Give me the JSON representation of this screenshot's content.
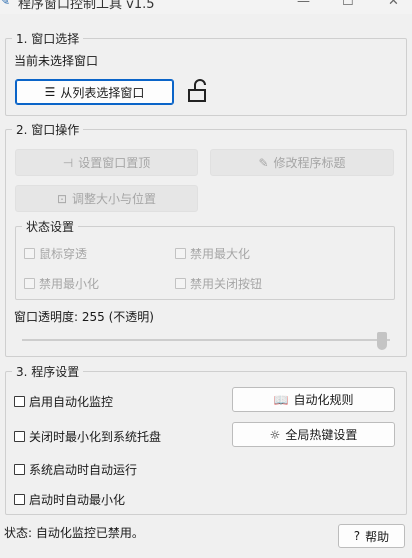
{
  "window": {
    "title": "程序窗口控制工具 v1.5"
  },
  "section_select": {
    "legend": "1. 窗口选择",
    "current_window_text": "当前未选择窗口",
    "select_button_label": "从列表选择窗口"
  },
  "section_ops": {
    "legend": "2. 窗口操作",
    "pin_label": "设置窗口置顶",
    "rename_label": "修改程序标题",
    "resize_label": "调整大小与位置",
    "status_group": {
      "legend": "状态设置",
      "mouse_through": "鼠标穿透",
      "disable_maximize": "禁用最大化",
      "disable_minimize": "禁用最小化",
      "disable_close": "禁用关闭按钮"
    },
    "opacity_label": "窗口透明度: 255 (不透明)",
    "opacity_value": 255,
    "opacity_max": 255
  },
  "section_settings": {
    "legend": "3. 程序设置",
    "enable_monitor": "启用自动化监控",
    "close_to_tray": "关闭时最小化到系统托盘",
    "autostart": "系统启动时自动运行",
    "start_minimized": "启动时自动最小化",
    "rules_label": "自动化规则",
    "hotkey_label": "全局热键设置"
  },
  "statusbar": {
    "status_text": "状态: 自动化监控已禁用。",
    "help_label": "帮助"
  },
  "colors": {
    "accent": "#0a64c8",
    "disabled_text": "#a6a6a6"
  }
}
